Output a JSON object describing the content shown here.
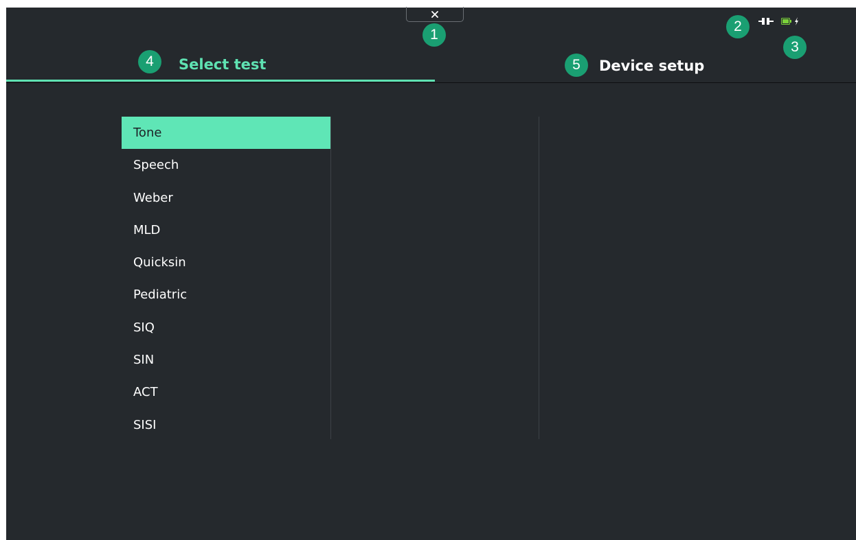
{
  "window": {
    "close_icon": "x-icon",
    "close_label": "×"
  },
  "callouts": {
    "c1": "1",
    "c2": "2",
    "c3": "3",
    "c4": "4",
    "c5": "5"
  },
  "status": {
    "power_icon": "power-plug-icon",
    "battery_icon": "battery-icon",
    "charging_icon": "lightning-bolt-icon",
    "battery_color": "#7bd13a"
  },
  "tabs": [
    {
      "label": "Select test",
      "active": true
    },
    {
      "label": "Device setup",
      "active": false
    }
  ],
  "tests": {
    "items": [
      "Tone",
      "Speech",
      "Weber",
      "MLD",
      "Quicksin",
      "Pediatric",
      "SIQ",
      "SIN",
      "ACT",
      "SISI"
    ],
    "selected": "Tone"
  },
  "colors": {
    "background": "#25292d",
    "accent": "#5fe2b2",
    "callout": "#1a9f72"
  }
}
